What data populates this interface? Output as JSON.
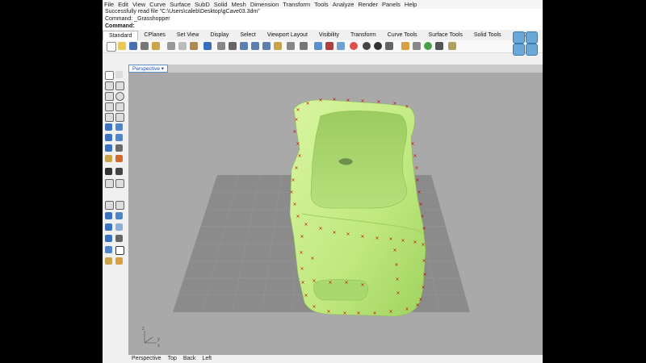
{
  "menu": [
    "File",
    "Edit",
    "View",
    "Curve",
    "Surface",
    "SubD",
    "Solid",
    "Mesh",
    "Dimension",
    "Transform",
    "Tools",
    "Analyze",
    "Render",
    "Panels",
    "Help"
  ],
  "command_history": [
    "Successfully read file \"C:\\Users\\caleb\\Desktop\\gCave03.3dm\"",
    "Command: _Grasshopper"
  ],
  "command_prompt": "Command:",
  "toolbar_tabs": [
    "Standard",
    "CPlanes",
    "Set View",
    "Display",
    "Select",
    "Viewport Layout",
    "Visibility",
    "Transform",
    "Curve Tools",
    "Surface Tools",
    "Solid Tools",
    "SubD To"
  ],
  "active_tab_index": 0,
  "viewport": {
    "title": "Perspective",
    "axis_labels": {
      "z": "z",
      "y": "y",
      "x": "x"
    },
    "colors": {
      "background": "#a9a9a9",
      "grid": "#8b8b8b",
      "surface": "#c8f08a",
      "control_points": "#cc0000"
    }
  },
  "viewport_tabs": [
    "Perspective",
    "Top",
    "Back",
    "Left"
  ],
  "icons": [
    "new-icon",
    "open-icon",
    "save-icon",
    "print-icon",
    "import-icon",
    "cut-icon",
    "copy-icon",
    "paste-icon",
    "undo-icon",
    "pan-icon",
    "rotate-view-icon",
    "zoom-icon",
    "zoom-window-icon",
    "zoom-extents-icon",
    "zoom-selected-icon",
    "grid-icon",
    "layer-icon",
    "properties-icon",
    "car-icon",
    "render-icon",
    "sphere-icon",
    "material-icon",
    "lights-icon",
    "settings-icon",
    "help-icon",
    "sphere-view-icon",
    "cube-view-icon"
  ]
}
